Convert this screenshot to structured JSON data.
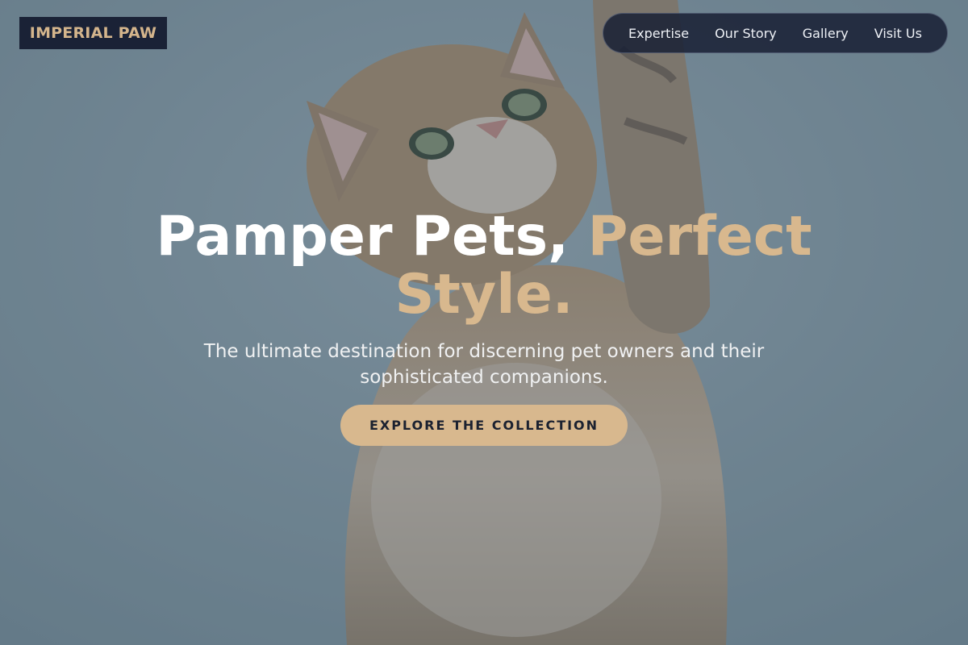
{
  "brand": {
    "logo_text": "IMPERIAL PAW"
  },
  "nav": {
    "items": [
      {
        "label": "Expertise"
      },
      {
        "label": "Our Story"
      },
      {
        "label": "Gallery"
      },
      {
        "label": "Visit Us"
      }
    ]
  },
  "hero": {
    "headline_main": "Pamper Pets, ",
    "headline_accent": "Perfect Style.",
    "subtitle": "The ultimate destination for discerning pet owners and their sophisticated companions.",
    "cta_label": "EXPLORE THE COLLECTION",
    "background_image": "kitten-reaching-up-photo"
  },
  "colors": {
    "accent": "#d8b88e",
    "navy": "#1a2236",
    "background": "#8aa0ab"
  }
}
